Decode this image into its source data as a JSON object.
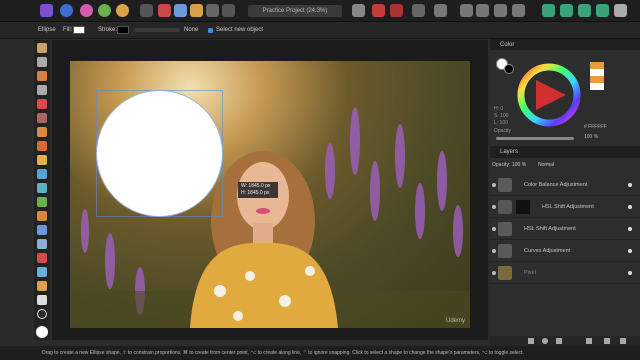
{
  "topbar": {
    "document_title": "Practice Project (24.3%)"
  },
  "context_toolbar": {
    "tool_name": "Ellipse",
    "fill_label": "Fill:",
    "stroke_label": "Stroke:",
    "stroke_style": "None",
    "select_new_label": "Select new object",
    "fill_color": "#ffffff",
    "stroke_color": "#000000"
  },
  "canvas": {
    "tooltip_w": "W: 1845.0 px",
    "tooltip_h": "H: 1845.0 px",
    "watermark": "Udemy"
  },
  "color_panel": {
    "title": "Color",
    "h_label": "H: 0",
    "s_label": "S: 100",
    "l_label": "L: 100",
    "opacity_label": "Opacity",
    "opacity_value": "100 %",
    "hex_value": "# FFFFFF"
  },
  "layers_panel": {
    "title": "Layers",
    "opacity_label": "Opacity:",
    "opacity_value": "100 %",
    "blend_mode": "Normal",
    "layers": [
      {
        "name": "Color Balance Adjustment",
        "color": "#5a5a5a"
      },
      {
        "name": "HSL Shift Adjustment",
        "color": "#1a1a1a"
      },
      {
        "name": "HSL Shift Adjustment",
        "color": "#5a5a5a"
      },
      {
        "name": "Curves Adjustment",
        "color": "#5a5a5a"
      },
      {
        "name": "Pixel",
        "color": "#7a6a3a"
      }
    ]
  },
  "status_bar": {
    "text": "Drag to create a new Ellipse shape, ⇧ to constrain proportions, ⌘ to create from center point, ⌥ to create along line, ⌃ to ignore snapping. Click to select a shape to change the shape's parameters, ⌥ to toggle select."
  }
}
